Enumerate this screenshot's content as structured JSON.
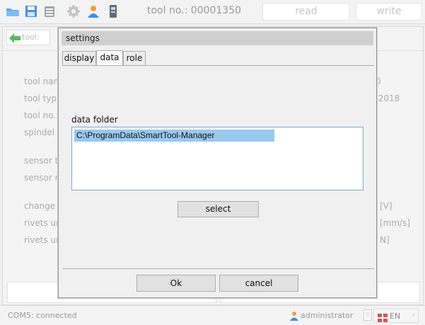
{
  "toolbar": {
    "tool_no": "tool no.: 00001350",
    "read_label": "read",
    "write_label": "write"
  },
  "main": {
    "back_label": "tool:",
    "rows": [
      {
        "label": "tool nam",
        "value": "0"
      },
      {
        "label": "tool typ",
        "value": ".2018"
      },
      {
        "label": "tool no.:",
        "value": ""
      },
      {
        "label": "spindel",
        "value": ""
      },
      {
        "label": "sensor t",
        "value": ""
      },
      {
        "label": "sensor n",
        "value": ""
      },
      {
        "label": "change",
        "value": "[V]"
      },
      {
        "label": "rivets ur",
        "value": "[mm/s]"
      },
      {
        "label": "rivets ur",
        "value": "N]"
      }
    ]
  },
  "dialog": {
    "title": "settings",
    "tabs": [
      {
        "label": "display",
        "active": false
      },
      {
        "label": "data",
        "active": true
      },
      {
        "label": "role",
        "active": false
      }
    ],
    "data_folder_label": "data folder",
    "data_folder_path": "C:\\ProgramData\\SmartTool-Manager",
    "select_label": "select",
    "ok_label": "Ok",
    "cancel_label": "cancel"
  },
  "status": {
    "connection": "COM5: connected",
    "user": "administrator",
    "language": "EN"
  },
  "colors": {
    "accent_blue": "#3a8ee6",
    "selection": "#99c9ef",
    "back_arrow": "#5cb85c",
    "lang_flag": "#d9534f"
  }
}
